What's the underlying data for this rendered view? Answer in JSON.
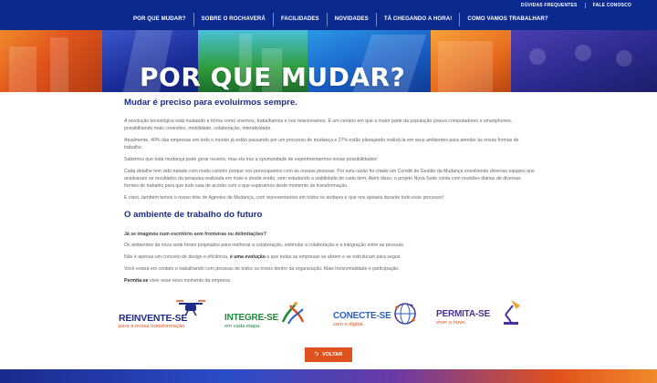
{
  "util_nav": {
    "faq": "DÚVIDAS FREQUENTES",
    "contact": "FALE CONOSCO"
  },
  "nav": {
    "items": [
      "POR QUE MUDAR?",
      "SOBRE O ROCHAVERÁ",
      "FACILIDADES",
      "NOVIDADES",
      "TÁ CHEGANDO A HORA!",
      "COMO VAMOS TRABALHAR?"
    ]
  },
  "hero": {
    "title": "POR QUE MUDAR?"
  },
  "section1": {
    "heading": "Mudar é preciso para evoluirmos sempre.",
    "paragraphs": [
      "A revolução tecnológica está mudando a forma como vivemos, trabalhamos e nos relacionamos. É um cenário em que a maior parte da população possui computadores e smartphones, possibilitando mais conexões, mobilidade, colaboração, interatividade.",
      "Atualmente, 40% das empresas em todo o mundo já estão passando por um processo de mudança e 27% estão planejando realizá-la em seus ambientes para atender às novas formas de trabalho.",
      "Sabemos que toda mudança pode gerar receios, mas ela traz a oportunidade de experimentarmos novas possibilidades!",
      "Cada detalhe tem sido tratado com muito carinho porque nos preocupamos com as nossas pessoas. Por esta razão foi criado um Comitê de Gestão da Mudança envolvendo diversas equipes que analisaram os resultados da pesquisa realizada em maio e desde então, vem estudando a viabilidade de cada item. Além disso, o projeto Nova Sede conta com reuniões diárias de diversas frentes de trabalho para que tudo saia de acordo com o que esperamos deste momento de transformação.",
      "E claro, também temos o nosso time de Agentes de Mudança, com representantes em todos os andares e que nos apoiará durante todo esse processo!"
    ]
  },
  "section2": {
    "heading": "O ambiente de trabalho do futuro",
    "question": "Já se imaginou num escritório sem fronteiras ou delimitações?",
    "p1": "Os ambientes da nova sede foram projetados para melhorar a colaboração, estimular a colaboração e a integração entre as pessoas.",
    "p2_before": "Não é apenas um conceito de design e eficiência, ",
    "p2_bold": "é uma evolução",
    "p2_after": " a que todas as empresas se abrem e se estruturam para seguir.",
    "p3": "Você estará em contato e trabalhando com pessoas de todos os níveis dentro da organização. Mais horizontalidade e participação.",
    "p4_bold": "Permita-se",
    "p4_after": " viver esse novo momento da empresa."
  },
  "logos": [
    {
      "word": "REINVENTE-SE",
      "sub": "para a nossa transformação.",
      "color": "#1d2c8a",
      "accent": "#e0531c"
    },
    {
      "word": "INTEGRE-SE",
      "sub": "em cada etapa.",
      "color": "#1f8a3a",
      "accent": "#1f8a3a"
    },
    {
      "word": "CONECTE-SE",
      "sub": "com o digital.",
      "color": "#2a5fc7",
      "accent": "#e0531c"
    },
    {
      "word": "PERMITA-SE",
      "sub": "viver o novo.",
      "color": "#4a2fa0",
      "accent": "#4a2fa0"
    }
  ],
  "button": {
    "label": "VOLTAR",
    "icon": "back-arrow-icon"
  },
  "colors": {
    "nav_bg": "#0b2a8f",
    "heading": "#1d2c8a",
    "button": "#e0531c"
  }
}
